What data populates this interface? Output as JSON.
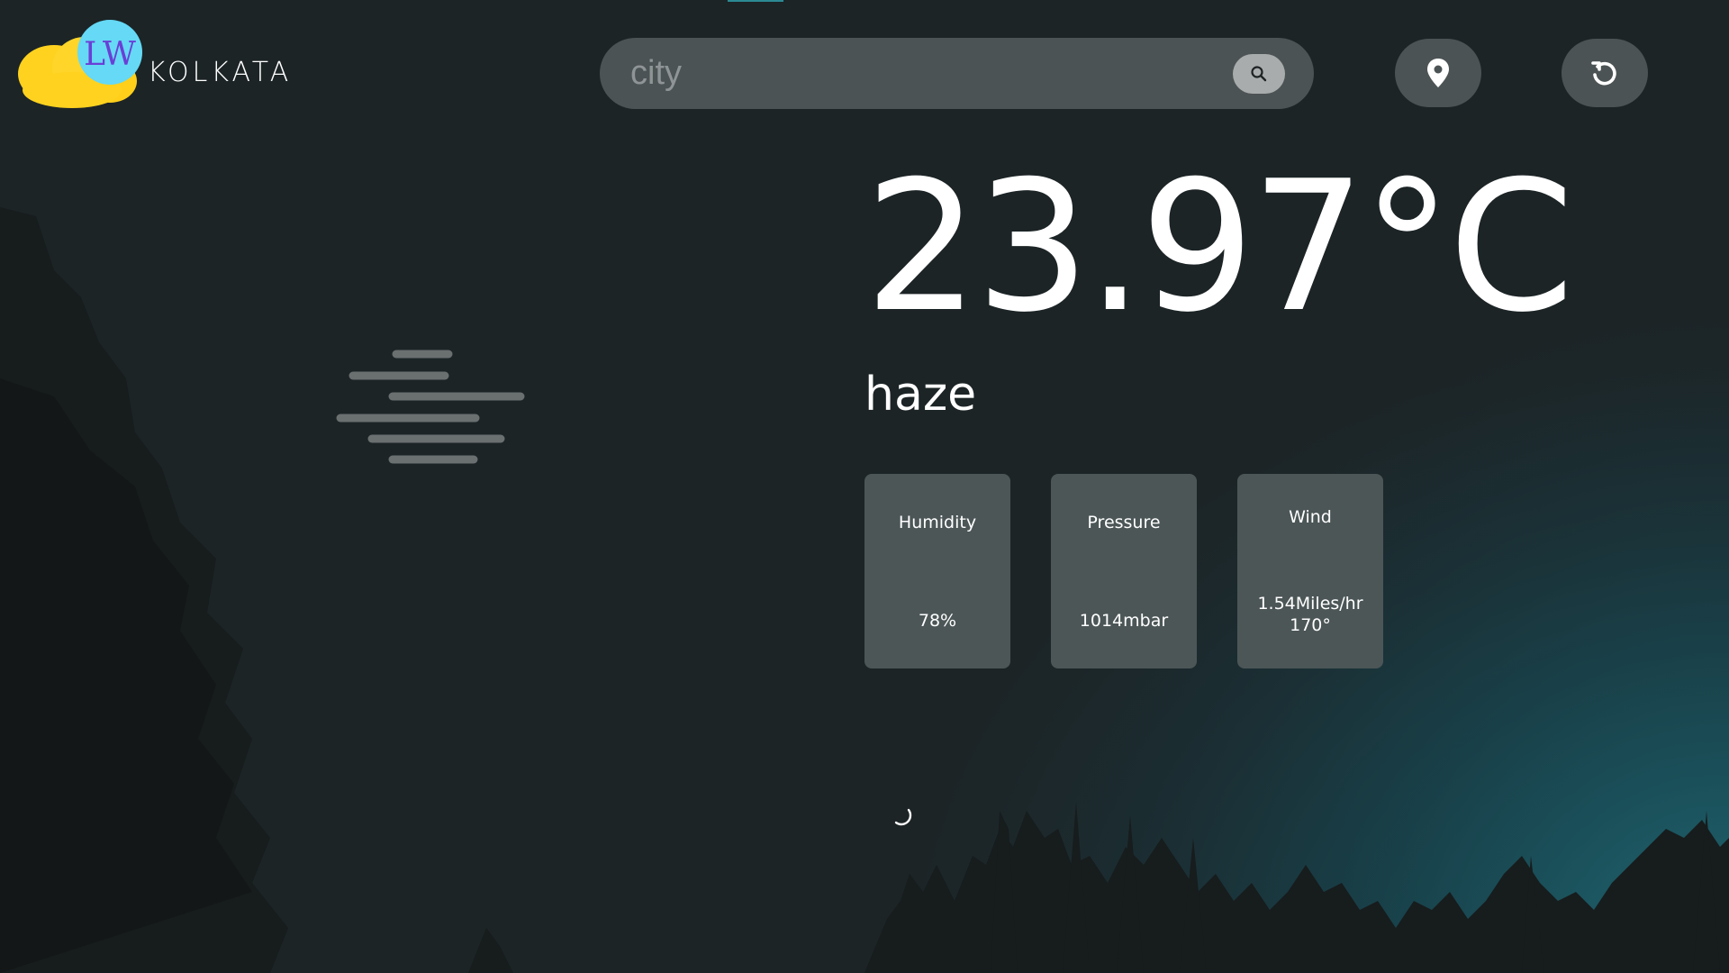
{
  "header": {
    "logo_text": "LW",
    "city": "KOLKATA"
  },
  "search": {
    "placeholder": "city",
    "value": ""
  },
  "icons": {
    "search": "search-icon",
    "location": "map-pin-icon",
    "refresh": "refresh-icon",
    "weather": "haze-icon",
    "loading": "spinner-icon"
  },
  "weather": {
    "temperature": "23.97°C",
    "condition": "haze"
  },
  "stats": {
    "humidity": {
      "label": "Humidity",
      "value": "78%"
    },
    "pressure": {
      "label": "Pressure",
      "value": "1014mbar"
    },
    "wind": {
      "label": "Wind",
      "speed": "1.54Miles/hr",
      "direction": "170°"
    }
  },
  "colors": {
    "background": "#1c2426",
    "teal_glow": "#1c5560",
    "panel": "#4c5354",
    "logo_cloud": "#ffd21f",
    "logo_badge": "#4fd3f0"
  }
}
